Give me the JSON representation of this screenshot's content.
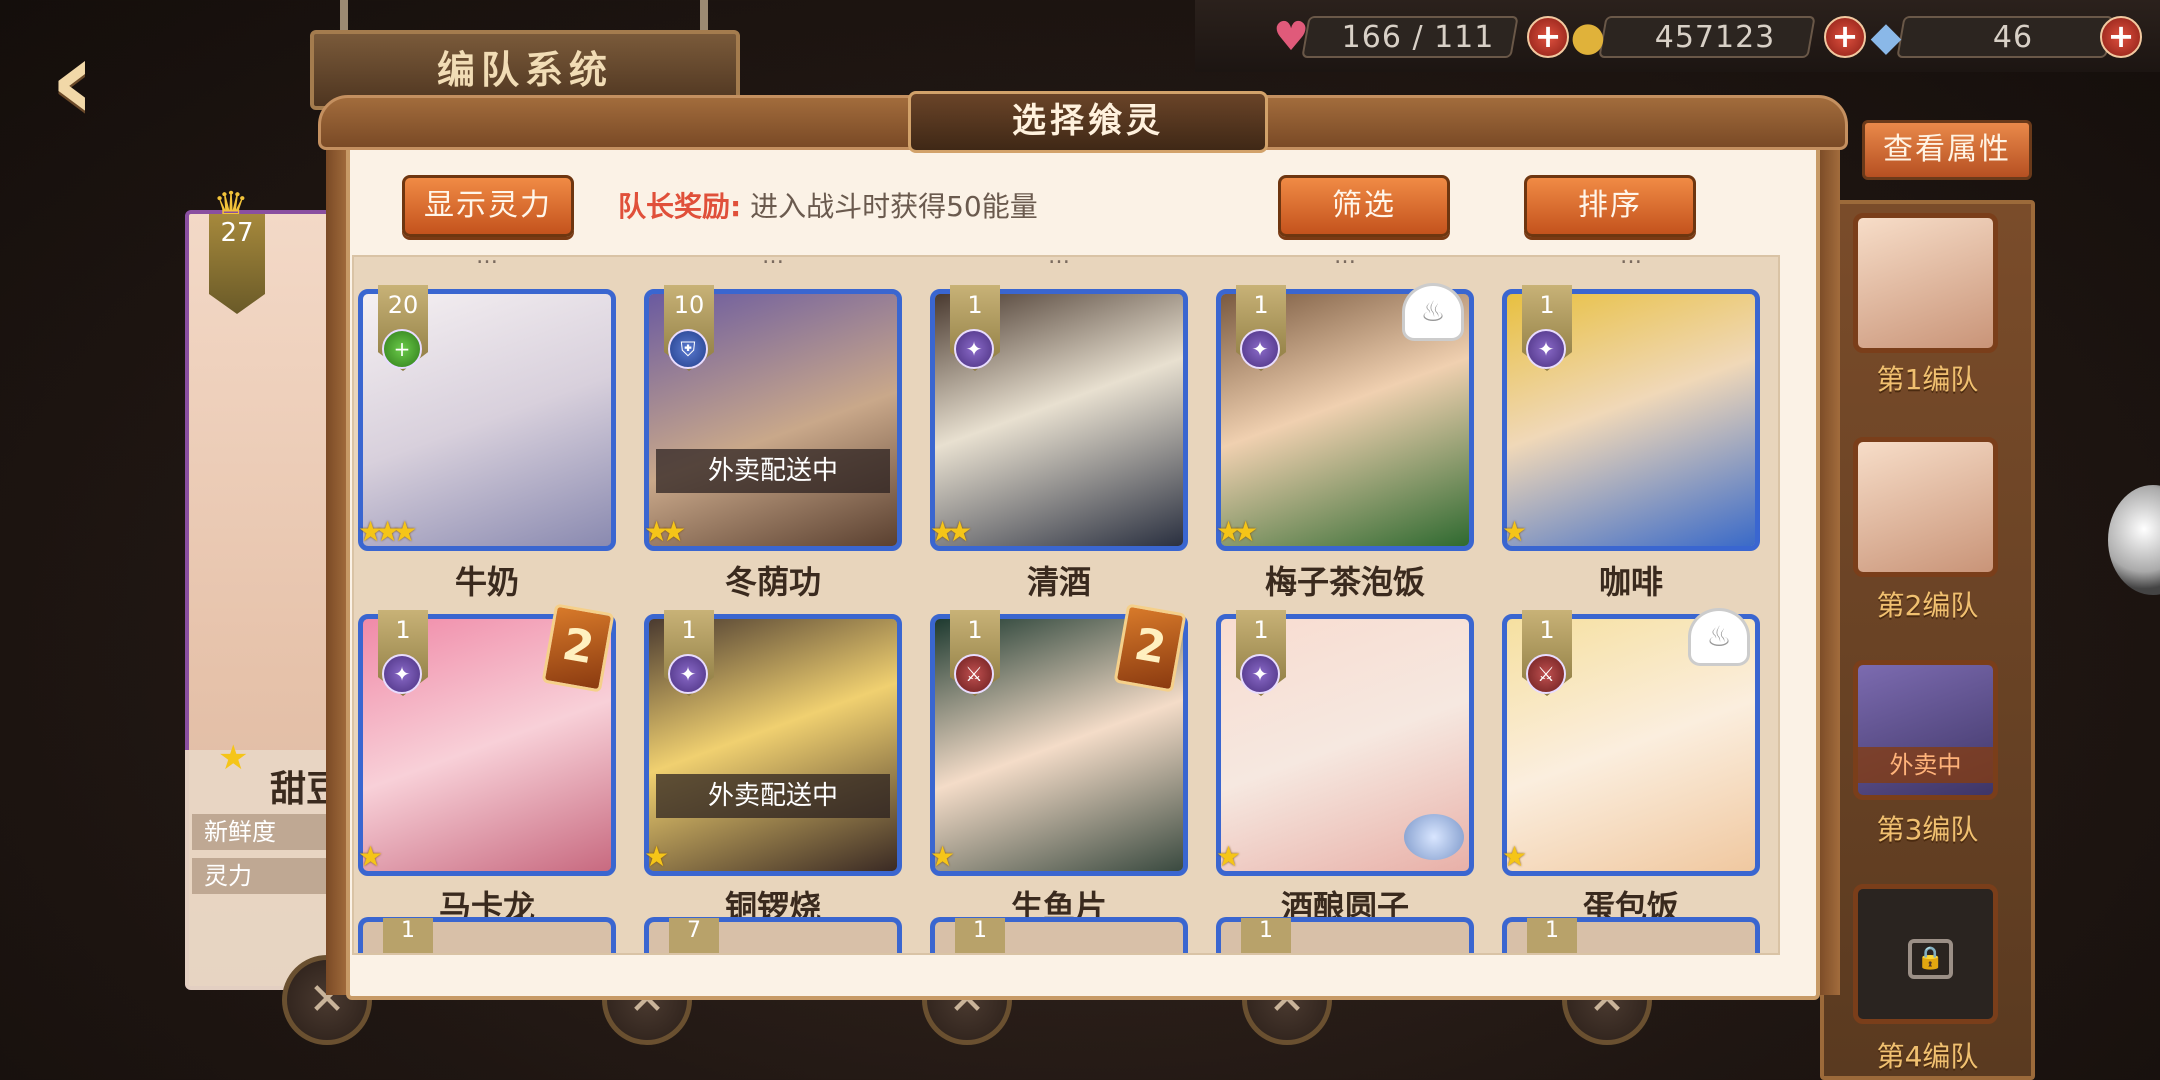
{
  "header": {
    "title": "编队系统",
    "back_icon": "back-arrow-icon"
  },
  "resources": [
    {
      "icon": "heart-icon",
      "value": "166 / 111"
    },
    {
      "icon": "coin-icon",
      "value": "457123"
    },
    {
      "icon": "crystal-icon",
      "value": "46"
    }
  ],
  "left_character": {
    "level": "27",
    "name": "甜豆",
    "stats": [
      "新鲜度",
      "灵力"
    ]
  },
  "right_panel": {
    "view_attr_label": "查看属性",
    "teams": [
      {
        "label": "第1编队",
        "status": ""
      },
      {
        "label": "第2编队",
        "status": ""
      },
      {
        "label": "第3编队",
        "status": "外卖中"
      },
      {
        "label": "第4编队",
        "status": ""
      }
    ]
  },
  "modal": {
    "title": "选择飨灵",
    "show_power_label": "显示灵力",
    "filter_label": "筛选",
    "sort_label": "排序",
    "leader_bonus_key": "队长奖励:",
    "leader_bonus_text": "进入战斗时获得50能量",
    "top_partial_names": [
      "…",
      "…",
      "…",
      "…",
      "…"
    ],
    "cards": [
      {
        "name": "牛奶",
        "level": "20",
        "stars": 3,
        "type": "green",
        "status": "",
        "badge": ""
      },
      {
        "name": "冬荫功",
        "level": "10",
        "stars": 2,
        "type": "blue",
        "status": "外卖配送中",
        "badge": ""
      },
      {
        "name": "清酒",
        "level": "1",
        "stars": 2,
        "type": "purple",
        "status": "",
        "badge": ""
      },
      {
        "name": "梅子茶泡饭",
        "level": "1",
        "stars": 2,
        "type": "purple",
        "status": "",
        "badge": "hat"
      },
      {
        "name": "咖啡",
        "level": "1",
        "stars": 1,
        "type": "purple",
        "status": "",
        "badge": ""
      },
      {
        "name": "马卡龙",
        "level": "1",
        "stars": 1,
        "type": "purple",
        "status": "",
        "badge": "skin"
      },
      {
        "name": "铜锣烧",
        "level": "1",
        "stars": 1,
        "type": "purple",
        "status": "外卖配送中",
        "badge": ""
      },
      {
        "name": "生鱼片",
        "level": "1",
        "stars": 1,
        "type": "red",
        "status": "",
        "badge": "skin"
      },
      {
        "name": "酒酿圆子",
        "level": "1",
        "stars": 1,
        "type": "purple",
        "status": "",
        "badge": ""
      },
      {
        "name": "蛋包饭",
        "level": "1",
        "stars": 1,
        "type": "red",
        "status": "",
        "badge": "hat"
      }
    ],
    "partial_levels": [
      "1",
      "7",
      "1",
      "1",
      "1"
    ]
  },
  "colors": {
    "accent_orange": "#e07a3c",
    "card_border_blue": "#3a66d0",
    "bonus_red": "#e0503a",
    "star_gold": "#f5c518"
  }
}
